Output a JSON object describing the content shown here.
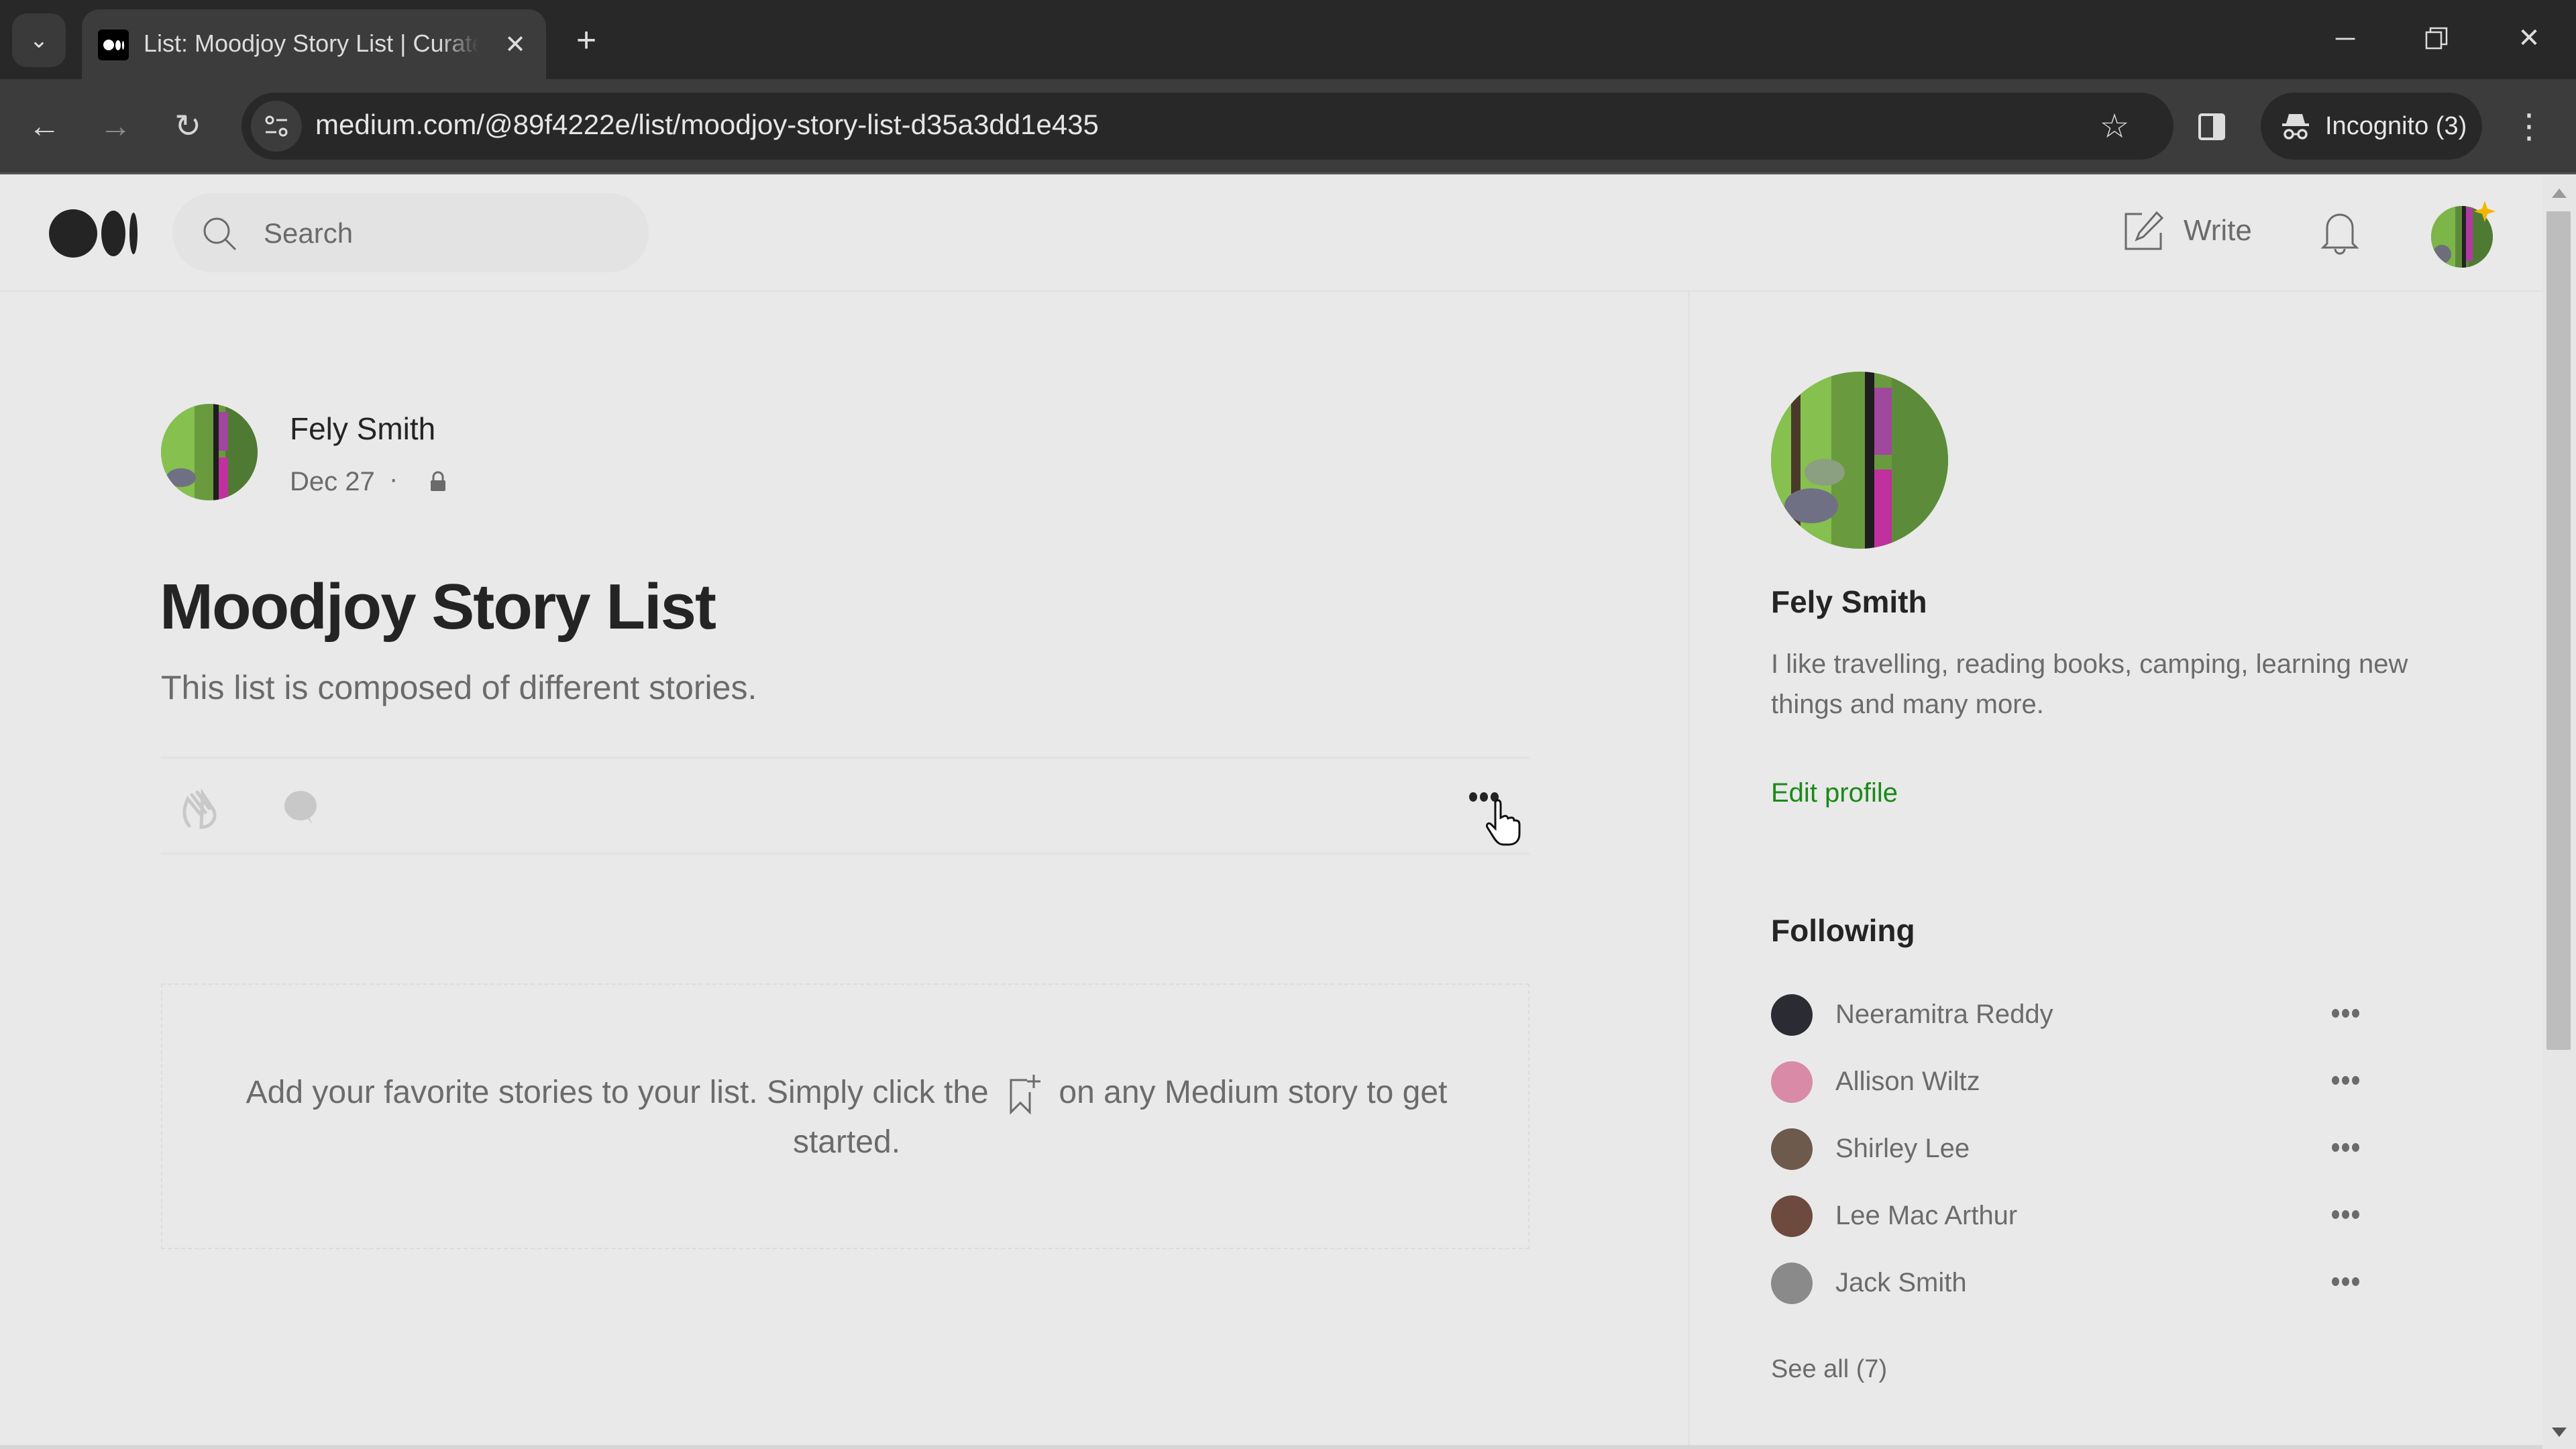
{
  "browser": {
    "tab_title": "List: Moodjoy Story List | Curated",
    "url": "medium.com/@89f4222e/list/moodjoy-story-list-d35a3dd1e435",
    "incognito_label": "Incognito (3)",
    "icons": {
      "tab_list": "chevron-down-icon",
      "close_tab": "close-icon",
      "new_tab": "plus-icon",
      "back": "arrow-left-icon",
      "forward": "arrow-right-icon",
      "reload": "reload-icon",
      "site_info": "tune-icon",
      "bookmark": "star-icon",
      "side_panel": "side-panel-icon",
      "incognito": "incognito-icon",
      "menu": "kebab-menu-icon",
      "minimize": "minimize-icon",
      "restore": "restore-icon",
      "close_window": "close-icon"
    }
  },
  "header": {
    "search_placeholder": "Search",
    "write_label": "Write"
  },
  "list": {
    "author_name": "Fely Smith",
    "date": "Dec 27",
    "separator": "·",
    "visibility": "private",
    "title": "Moodjoy Story List",
    "description": "This list is composed of different stories.",
    "empty_text_before": "Add your favorite stories to your list. Simply click the",
    "empty_text_after": "on any Medium story to get started."
  },
  "sidebar": {
    "profile_name": "Fely Smith",
    "bio": "I like travelling, reading books, camping, learning new things and many more.",
    "edit_profile_label": "Edit profile",
    "following_heading": "Following",
    "following": [
      {
        "name": "Neeramitra Reddy",
        "avatar_color": "#2b2b33"
      },
      {
        "name": "Allison Wiltz",
        "avatar_color": "#d98aa6"
      },
      {
        "name": "Shirley Lee",
        "avatar_color": "#6d5a4c"
      },
      {
        "name": "Lee Mac Arthur",
        "avatar_color": "#6e4a3e"
      },
      {
        "name": "Jack Smith",
        "avatar_color": "#8a8a8a"
      }
    ],
    "see_all_label": "See all (7)"
  },
  "colors": {
    "accent_green": "#1a8917",
    "text_primary": "#242424",
    "text_secondary": "#6b6b6b",
    "page_bg": "#e9e9e9"
  }
}
